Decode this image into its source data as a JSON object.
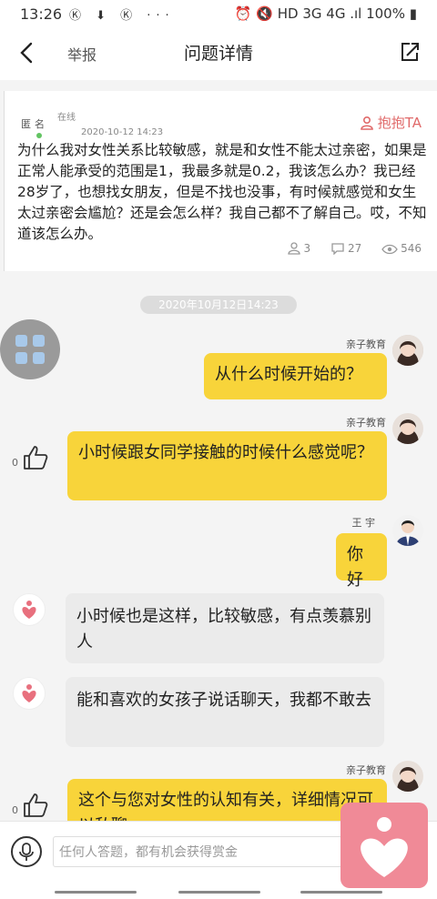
{
  "status": {
    "time": "13:26",
    "left_icons": "Ⓚ ⬇ Ⓚ ···",
    "right": "⏰ 🔇 HD 3G 4G .ıl 100% ▮"
  },
  "nav": {
    "report_label": "举报",
    "title": "问题详情"
  },
  "question": {
    "author": "匿名",
    "status": "在线",
    "date": "2020-10-12 14:23",
    "hug_label": "抱抱TA",
    "text": "为什么我对女性关系比较敏感，就是和女性不能太过亲密，如果是正常人能承受的范围是1，我最多就是0.2，我该怎么办？我已经28岁了，也想找女朋友，但是不找也没事，有时候就感觉和女生太过亲密会尴尬？还是会怎么样？我自己都不了解自己。哎，不知道该怎么办。",
    "stats": {
      "hugs": "3",
      "comments": "27",
      "views": "546"
    }
  },
  "chat": {
    "date_separator": "2020年10月12日14:23",
    "messages": [
      {
        "sender": "亲子教育",
        "text": "从什么时候开始的？"
      },
      {
        "sender": "亲子教育",
        "text": "小时候跟女同学接触的时候什么感觉呢？",
        "likes": "0"
      },
      {
        "sender": "王 宇",
        "text": "你好"
      },
      {
        "sender": "",
        "text": "小时候也是这样，比较敏感，有点羡慕别人"
      },
      {
        "sender": "",
        "text": "能和喜欢的女孩子说话聊天，我都不敢去"
      },
      {
        "sender": "亲子教育",
        "text": "这个与您对女性的认知有关，详细情况可以私聊",
        "likes": "0"
      }
    ]
  },
  "input": {
    "placeholder": "任何人答题，都有机会获得赏金"
  },
  "colors": {
    "accent_yellow": "#f8d43a",
    "hug_red": "#e06a6a",
    "heart_pink": "#f08a97"
  }
}
